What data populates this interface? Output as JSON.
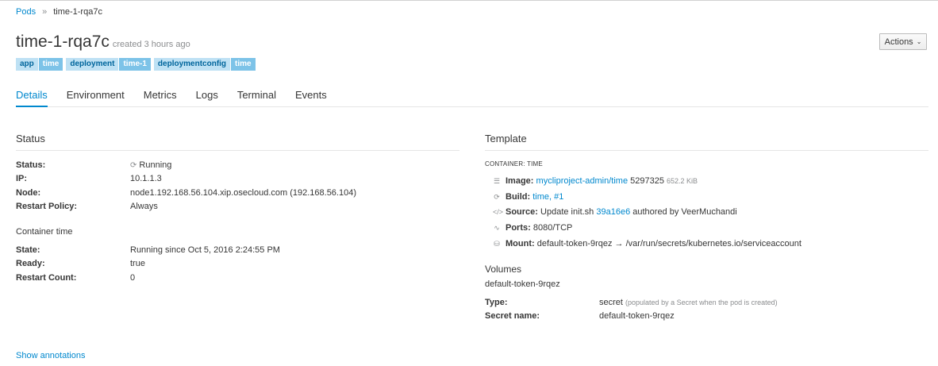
{
  "breadcrumb": {
    "parent": "Pods",
    "separator": "»",
    "current": "time-1-rqa7c"
  },
  "header": {
    "title": "time-1-rqa7c",
    "created": "created 3 hours ago",
    "actions_label": "Actions"
  },
  "labels": [
    {
      "key": "app",
      "value": "time"
    },
    {
      "key": "deployment",
      "value": "time-1"
    },
    {
      "key": "deploymentconfig",
      "value": "time"
    }
  ],
  "tabs": [
    "Details",
    "Environment",
    "Metrics",
    "Logs",
    "Terminal",
    "Events"
  ],
  "status": {
    "title": "Status",
    "rows": [
      {
        "label": "Status:",
        "value": "Running"
      },
      {
        "label": "IP:",
        "value": "10.1.1.3"
      },
      {
        "label": "Node:",
        "value": "node1.192.168.56.104.xip.osecloud.com (192.168.56.104)"
      },
      {
        "label": "Restart Policy:",
        "value": "Always"
      }
    ]
  },
  "container_time": {
    "title": "Container time",
    "rows": [
      {
        "label": "State:",
        "value": "Running since Oct 5, 2016 2:24:55 PM"
      },
      {
        "label": "Ready:",
        "value": "true"
      },
      {
        "label": "Restart Count:",
        "value": "0"
      }
    ]
  },
  "show_annotations": "Show annotations",
  "template": {
    "title": "Template",
    "container_label": "CONTAINER: TIME",
    "image": {
      "label": "Image:",
      "link": "mycliproject-admin/time",
      "id": "5297325",
      "size": "652.2 KiB"
    },
    "build": {
      "label": "Build:",
      "link_name": "time",
      "link_num": "#1"
    },
    "source": {
      "label": "Source:",
      "text": "Update init.sh",
      "commit": "39a16e6",
      "author": "authored by VeerMuchandi"
    },
    "ports": {
      "label": "Ports:",
      "value": "8080/TCP"
    },
    "mount": {
      "label": "Mount:",
      "value": "default-token-9rqez → /var/run/secrets/kubernetes.io/serviceaccount"
    }
  },
  "volumes": {
    "title": "Volumes",
    "name": "default-token-9rqez",
    "type_label": "Type:",
    "type_value": "secret",
    "type_note": "(populated by a Secret when the pod is created)",
    "secret_label": "Secret name:",
    "secret_value": "default-token-9rqez"
  }
}
